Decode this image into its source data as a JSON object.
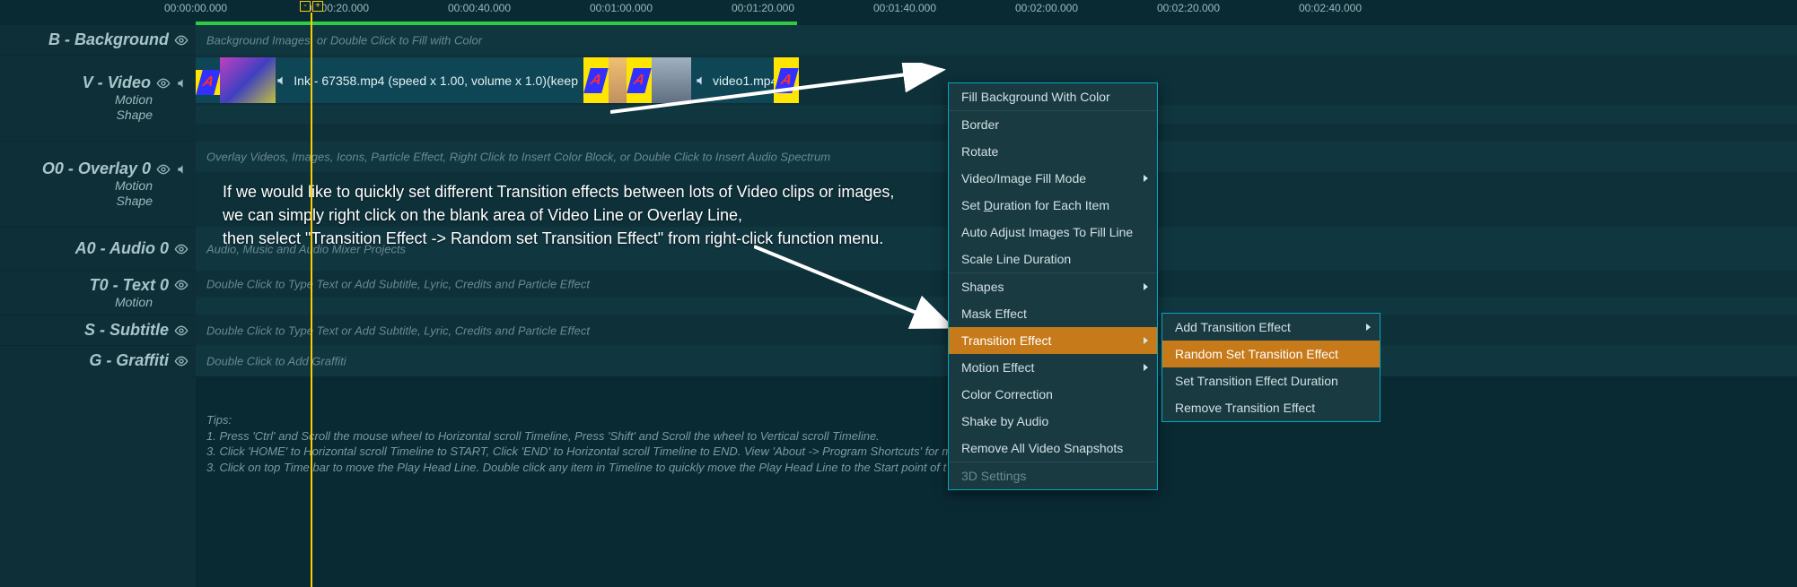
{
  "timecodes": [
    "00:00:00.000",
    "00:00:20.000",
    "00:00:40.000",
    "00:01:00.000",
    "00:01:20.000",
    "00:01:40.000",
    "00:02:00.000",
    "00:02:20.000",
    "00:02:40.000"
  ],
  "playhead": {
    "minus": "-",
    "plus": "+"
  },
  "tracks": {
    "background": {
      "title": "B - Background",
      "placeholder": "Background Images, or Double Click to Fill with Color"
    },
    "video": {
      "title": "V - Video",
      "motion": "Motion",
      "shape": "Shape",
      "clip1": "Ink - 67358.mp4  (speed x 1.00, volume x 1.0)(keep",
      "clip2": "video1.mp4",
      "trans": "A"
    },
    "overlay0": {
      "title": "O0 - Overlay 0",
      "placeholder": "Overlay Videos, Images, Icons, Particle Effect, Right Click to Insert Color Block, or Double Click to Insert Audio Spectrum",
      "motion": "Motion",
      "shape": "Shape"
    },
    "audio0": {
      "title": "A0 - Audio 0",
      "placeholder": "Audio, Music and Audio Mixer Projects"
    },
    "text0": {
      "title": "T0 - Text 0",
      "placeholder": "Double Click to Type Text or Add Subtitle, Lyric, Credits and Particle Effect",
      "motion": "Motion"
    },
    "subtitle": {
      "title": "S - Subtitle",
      "placeholder": "Double Click to Type Text or Add Subtitle, Lyric, Credits and Particle Effect"
    },
    "graffiti": {
      "title": "G - Graffiti",
      "placeholder": "Double Click to Add Graffiti"
    }
  },
  "overlay_help": {
    "line1": "If we would like to quickly set different Transition effects between lots of Video clips or images,",
    "line2": "we can simply right click on the blank area of Video Line or Overlay Line,",
    "line3": "then select \"Transition Effect -> Random set Transition Effect\" from right-click function menu."
  },
  "tips": {
    "heading": "Tips:",
    "t1": "1. Press 'Ctrl' and Scroll the mouse wheel to Horizontal scroll Timeline, Press 'Shift' and Scroll the wheel to Vertical scroll Timeline.",
    "t2": "3. Click 'HOME' to Horizontal scroll Timeline to START, Click 'END' to Horizontal scroll Timeline to END. View 'About -> Program Shortcuts' for m",
    "t3": "3. Click on top Time bar to move the Play Head Line. Double click any item in Timeline to quickly move the Play Head Line to the Start point of t"
  },
  "menu": {
    "fill_bg": "Fill Background With Color",
    "border": "Border",
    "rotate": "Rotate",
    "fill_mode": "Video/Image Fill Mode",
    "duration_each_pre": "Set ",
    "duration_each_key": "D",
    "duration_each_post": "uration for Each Item",
    "auto_adjust": "Auto Adjust Images To Fill Line",
    "scale_line": "Scale Line Duration",
    "shapes": "Shapes",
    "mask": "Mask Effect",
    "transition": "Transition Effect",
    "motion": "Motion Effect",
    "color_corr": "Color Correction",
    "shake": "Shake by Audio",
    "remove_snaps": "Remove All Video Snapshots",
    "threed": "3D Settings"
  },
  "submenu": {
    "add": "Add Transition Effect",
    "random": "Random Set Transition Effect",
    "set_dur": "Set Transition Effect Duration",
    "remove": "Remove Transition Effect"
  },
  "chart_data": null
}
